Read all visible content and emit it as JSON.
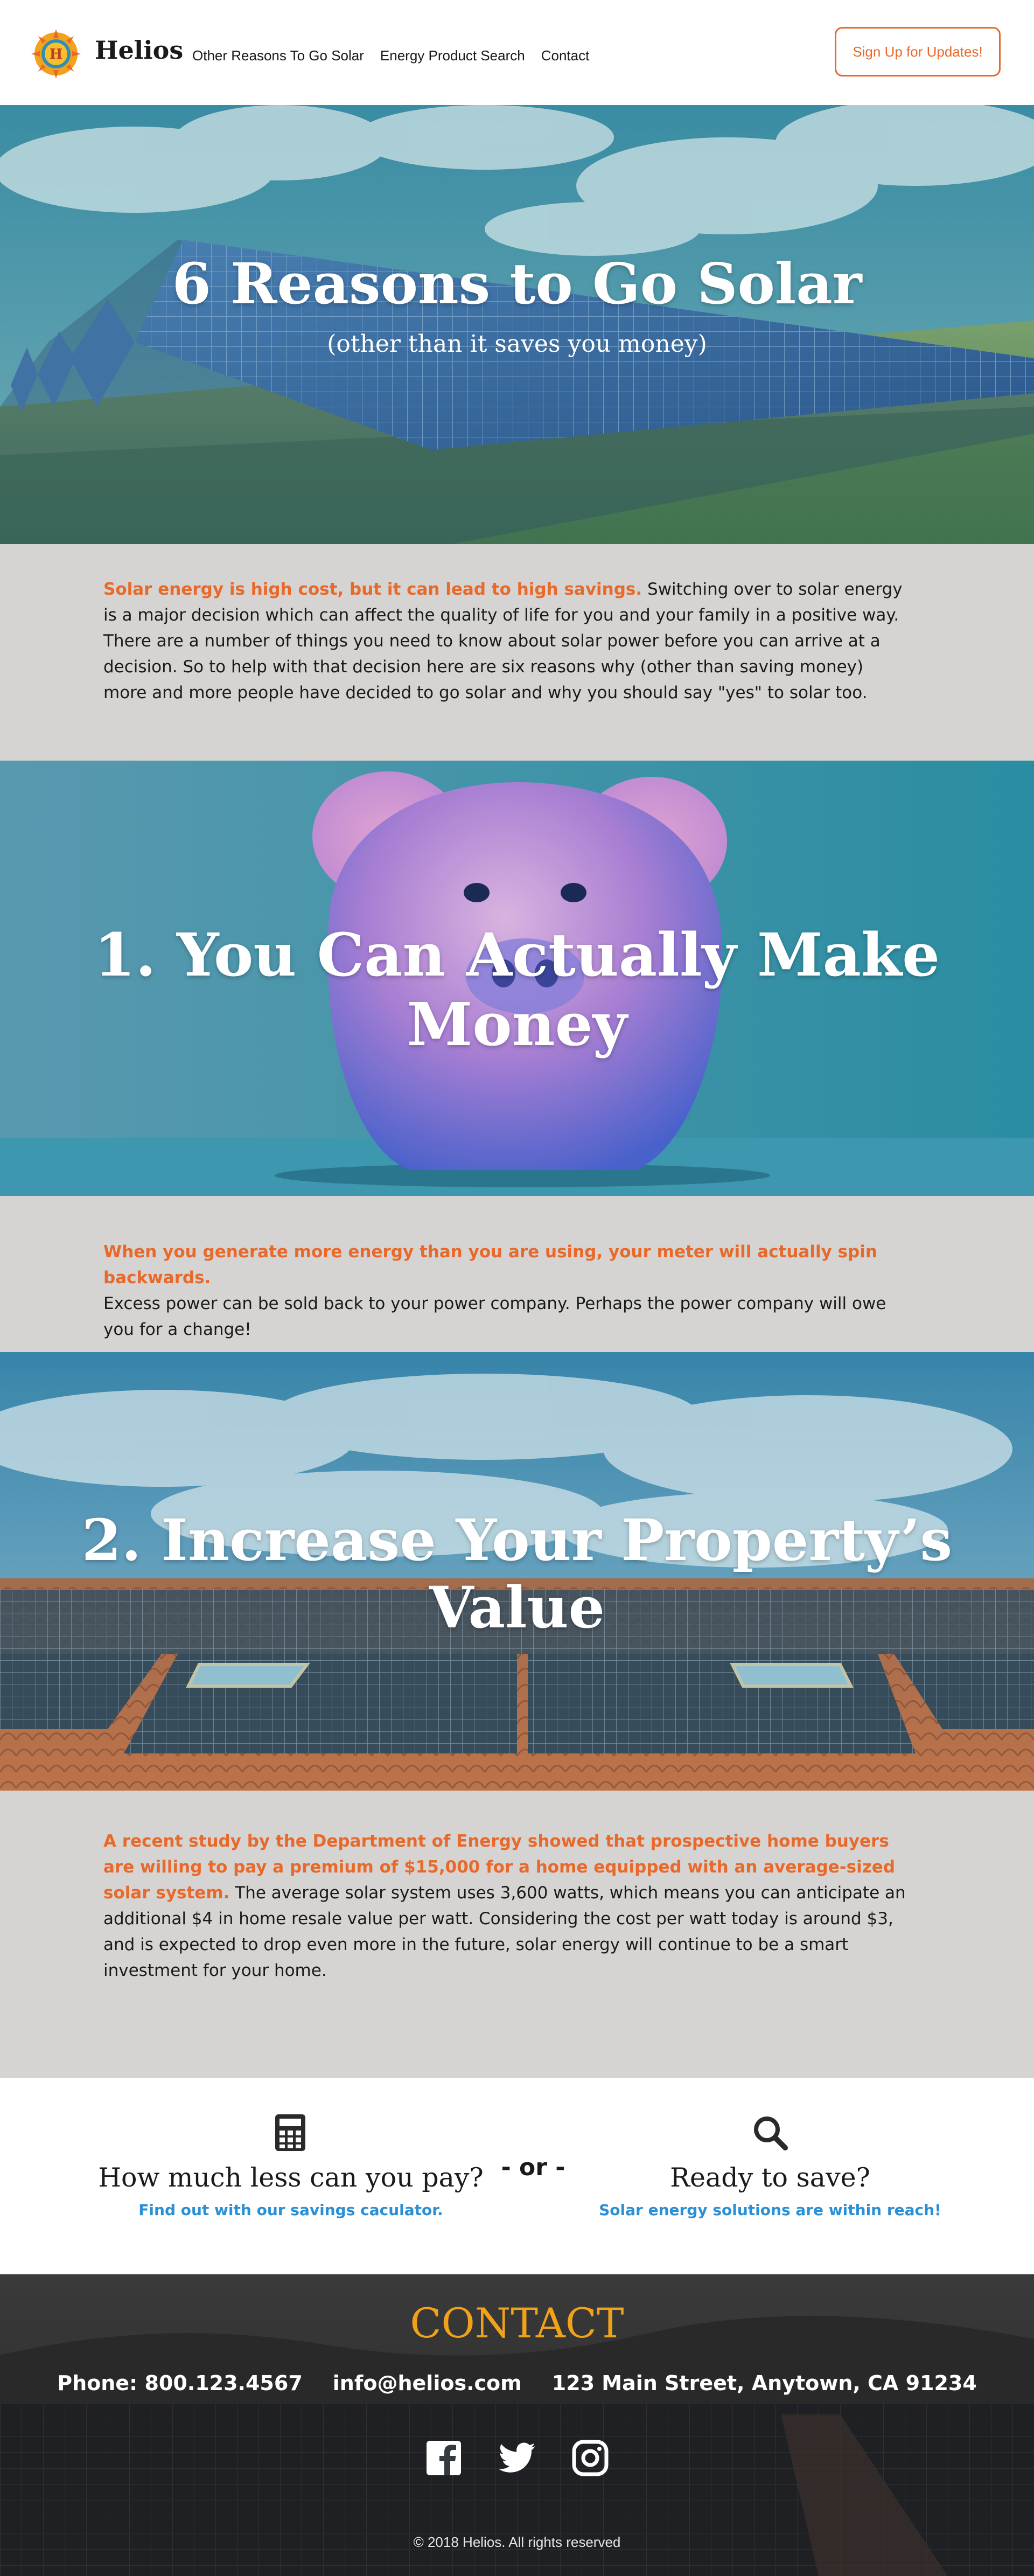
{
  "header": {
    "brand": "Helios",
    "logo_letter": "H",
    "nav": [
      {
        "label": "Other Reasons To Go Solar"
      },
      {
        "label": "Energy Product Search"
      },
      {
        "label": "Contact"
      }
    ],
    "signup_label": "Sign Up for Updates!"
  },
  "hero": {
    "title": "6 Reasons to Go Solar",
    "subtitle": "(other than it saves you money)"
  },
  "intro": {
    "highlight": "Solar energy is high cost, but it can lead to high savings.",
    "body": " Switching over to solar energy is a major decision which can affect the quality of life for you and your family in a positive way. There are a number of things you need to know about solar power before you can arrive at a decision. So to help with that decision here are six reasons why (other than saving money) more and more people have decided to go solar and why you should say \"yes\" to solar too."
  },
  "reason1": {
    "title": "1. You Can Actually Make Money",
    "highlight": "When you generate more energy than you are using, your meter will actually spin backwards.",
    "body": "Excess power can be sold back to your power company. Perhaps the power company will owe you for a change!"
  },
  "reason2": {
    "title": "2. Increase Your Property’s Value",
    "highlight": "A recent study by the Department of Energy showed that prospective home buyers are willing to pay a premium of $15,000 for a home equipped with an average-sized solar system.",
    "body": " The average solar system uses 3,600 watts, which means you can anticipate an additional $4 in home resale value per watt. Considering the cost per watt today is around $3, and is expected to drop even more in the future, solar energy will continue to be a smart investment for your home."
  },
  "cta": {
    "left_heading": "How much less can you pay?",
    "left_link": "Find out with our savings caculator.",
    "or_label": "- or -",
    "right_heading": "Ready to save?",
    "right_link": "Solar energy solutions are within reach!"
  },
  "footer": {
    "contact_title": "CONTACT",
    "phone": "Phone: 800.123.4567",
    "email": "info@helios.com",
    "address": "123 Main Street, Anytown, CA 91234",
    "copyright": "© 2018 Helios. All rights reserved"
  },
  "colors": {
    "accent": "#e8692a",
    "link": "#2b8fd6",
    "contact_title": "#f0a21a",
    "panel_bg": "#d5d4d2"
  },
  "icons": [
    "sun-logo-icon",
    "calculator-icon",
    "search-icon",
    "facebook-icon",
    "twitter-icon",
    "instagram-icon"
  ]
}
